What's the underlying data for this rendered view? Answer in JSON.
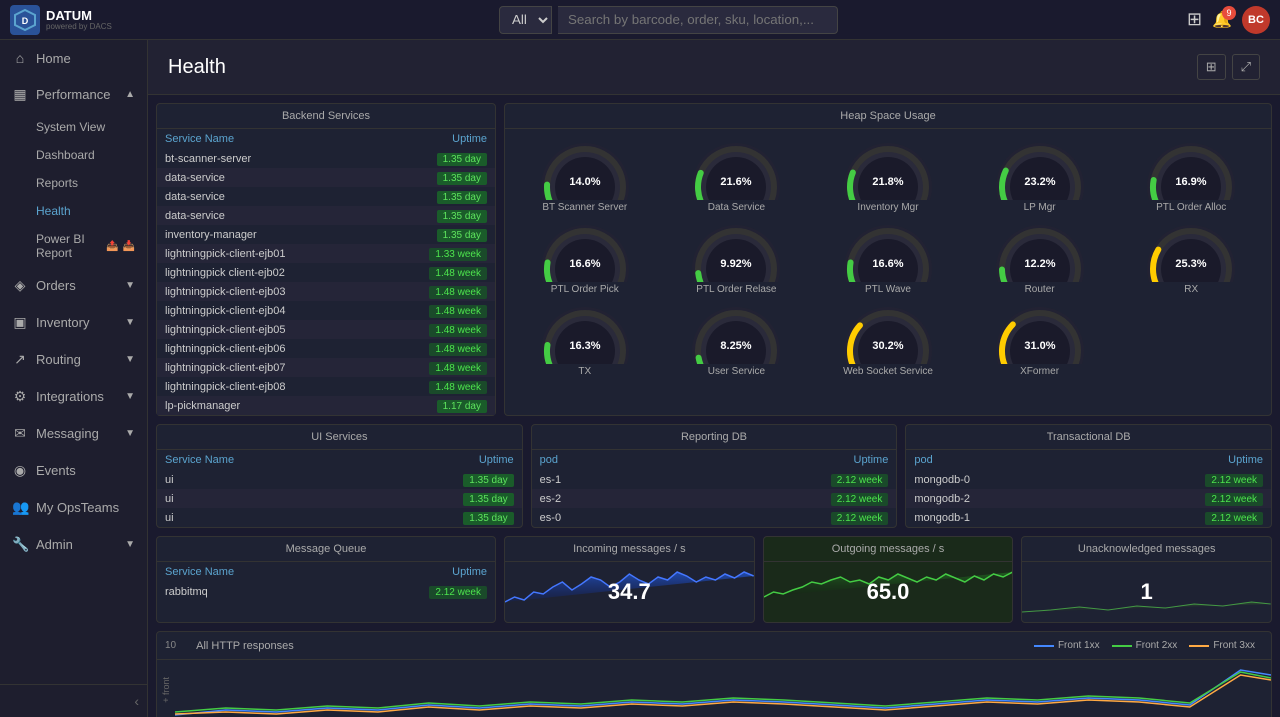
{
  "topbar": {
    "logo_text": "DATUM",
    "logo_sub": "powered by DACS",
    "logo_letter": "D",
    "search_placeholder": "Search by barcode, order, sku, location,...",
    "search_options": [
      "All"
    ],
    "notif_count": "9",
    "user_initials": "BC",
    "grid_icon": "⊞"
  },
  "sidebar": {
    "items": [
      {
        "id": "home",
        "label": "Home",
        "icon": "⌂"
      },
      {
        "id": "performance",
        "label": "Performance",
        "icon": "▦",
        "expanded": true
      },
      {
        "id": "system-view",
        "label": "System View",
        "indent": true
      },
      {
        "id": "dashboard",
        "label": "Dashboard",
        "indent": true
      },
      {
        "id": "reports",
        "label": "Reports",
        "indent": true
      },
      {
        "id": "health",
        "label": "Health",
        "indent": true,
        "active": true
      },
      {
        "id": "power-bi",
        "label": "Power BI Report",
        "indent": true
      },
      {
        "id": "orders",
        "label": "Orders",
        "icon": "◈"
      },
      {
        "id": "inventory",
        "label": "Inventory",
        "icon": "▣"
      },
      {
        "id": "routing",
        "label": "Routing",
        "icon": "↗"
      },
      {
        "id": "integrations",
        "label": "Integrations",
        "icon": "⚙"
      },
      {
        "id": "messaging",
        "label": "Messaging",
        "icon": "✉"
      },
      {
        "id": "events",
        "label": "Events",
        "icon": "◉"
      },
      {
        "id": "myopsteams",
        "label": "My OpsTeams",
        "icon": "👥"
      },
      {
        "id": "admin",
        "label": "Admin",
        "icon": "🔧"
      }
    ],
    "collapse_label": "‹"
  },
  "page": {
    "title": "Health"
  },
  "backend_services": {
    "title": "Backend Services",
    "col_name": "Service Name",
    "col_uptime": "Uptime",
    "rows": [
      {
        "name": "bt-scanner-server",
        "uptime": "1.35 day",
        "type": "day"
      },
      {
        "name": "data-service",
        "uptime": "1.35 day",
        "type": "day"
      },
      {
        "name": "data-service",
        "uptime": "1.35 day",
        "type": "day"
      },
      {
        "name": "data-service",
        "uptime": "1.35 day",
        "type": "day"
      },
      {
        "name": "inventory-manager",
        "uptime": "1.35 day",
        "type": "day"
      },
      {
        "name": "lightningpick-client-ejb01",
        "uptime": "1.33 week",
        "type": "week"
      },
      {
        "name": "lightningpick client-ejb02",
        "uptime": "1.48 week",
        "type": "week"
      },
      {
        "name": "lightningpick-client-ejb03",
        "uptime": "1.48 week",
        "type": "week"
      },
      {
        "name": "lightningpick-client-ejb04",
        "uptime": "1.48 week",
        "type": "week"
      },
      {
        "name": "lightningpick-client-ejb05",
        "uptime": "1.48 week",
        "type": "week"
      },
      {
        "name": "lightningpick-client-ejb06",
        "uptime": "1.48 week",
        "type": "week"
      },
      {
        "name": "lightningpick-client-ejb07",
        "uptime": "1.48 week",
        "type": "week"
      },
      {
        "name": "lightningpick-client-ejb08",
        "uptime": "1.48 week",
        "type": "week"
      },
      {
        "name": "lp-pickmanager",
        "uptime": "1.17 day",
        "type": "day"
      }
    ]
  },
  "heap_space": {
    "title": "Heap Space Usage",
    "gauges": [
      {
        "label": "BT Scanner Server",
        "value": 14.0,
        "pct": "14.0%"
      },
      {
        "label": "Data Service",
        "value": 21.6,
        "pct": "21.6%"
      },
      {
        "label": "Inventory Mgr",
        "value": 21.8,
        "pct": "21.8%"
      },
      {
        "label": "LP Mgr",
        "value": 23.2,
        "pct": "23.2%"
      },
      {
        "label": "PTL Order Alloc",
        "value": 16.9,
        "pct": "16.9%"
      },
      {
        "label": "PTL Order Pick",
        "value": 16.6,
        "pct": "16.6%"
      },
      {
        "label": "PTL Order Relase",
        "value": 9.92,
        "pct": "9.92%"
      },
      {
        "label": "PTL Wave",
        "value": 16.6,
        "pct": "16.6%"
      },
      {
        "label": "Router",
        "value": 12.2,
        "pct": "12.2%"
      },
      {
        "label": "RX",
        "value": 25.3,
        "pct": "25.3%"
      },
      {
        "label": "TX",
        "value": 16.3,
        "pct": "16.3%"
      },
      {
        "label": "User Service",
        "value": 8.25,
        "pct": "8.25%"
      },
      {
        "label": "Web Socket Service",
        "value": 30.2,
        "pct": "30.2%"
      },
      {
        "label": "XFormer",
        "value": 31.0,
        "pct": "31.0%"
      }
    ]
  },
  "ui_services": {
    "title": "UI Services",
    "col_name": "Service Name",
    "col_uptime": "Uptime",
    "rows": [
      {
        "name": "ui",
        "uptime": "1.35 day"
      },
      {
        "name": "ui",
        "uptime": "1.35 day"
      },
      {
        "name": "ui",
        "uptime": "1.35 day"
      }
    ]
  },
  "reporting_db": {
    "title": "Reporting DB",
    "col_pod": "pod",
    "col_uptime": "Uptime",
    "rows": [
      {
        "name": "es-1",
        "uptime": "2.12 week"
      },
      {
        "name": "es-2",
        "uptime": "2.12 week"
      },
      {
        "name": "es-0",
        "uptime": "2.12 week"
      }
    ]
  },
  "transactional_db": {
    "title": "Transactional DB",
    "col_pod": "pod",
    "col_uptime": "Uptime",
    "rows": [
      {
        "name": "mongodb-0",
        "uptime": "2.12 week"
      },
      {
        "name": "mongodb-2",
        "uptime": "2.12 week"
      },
      {
        "name": "mongodb-1",
        "uptime": "2.12 week"
      }
    ]
  },
  "message_queue": {
    "title": "Message Queue",
    "col_name": "Service Name",
    "col_uptime": "Uptime",
    "rows": [
      {
        "name": "rabbitmq",
        "uptime": "2.12 week"
      }
    ]
  },
  "incoming_messages": {
    "title": "Incoming messages / s",
    "value": "34.7"
  },
  "outgoing_messages": {
    "title": "Outgoing messages / s",
    "value": "65.0"
  },
  "unacknowledged_messages": {
    "title": "Unacknowledged messages",
    "value": "1"
  },
  "http_responses": {
    "title": "All HTTP responses",
    "legend": [
      {
        "label": "Front 1xx",
        "color": "#4488ff"
      },
      {
        "label": "Front 2xx",
        "color": "#44cc44"
      },
      {
        "label": "Front 3xx",
        "color": "#ffaa44"
      }
    ]
  },
  "colors": {
    "accent": "#5ba4cf",
    "success": "#4de44d",
    "warning": "#ffaa00",
    "danger": "#e74c3c",
    "gauge_bg": "#2a2a3a",
    "gauge_green": "#4de44d",
    "gauge_yellow": "#ffcc00",
    "gauge_red": "#e74c3c"
  }
}
